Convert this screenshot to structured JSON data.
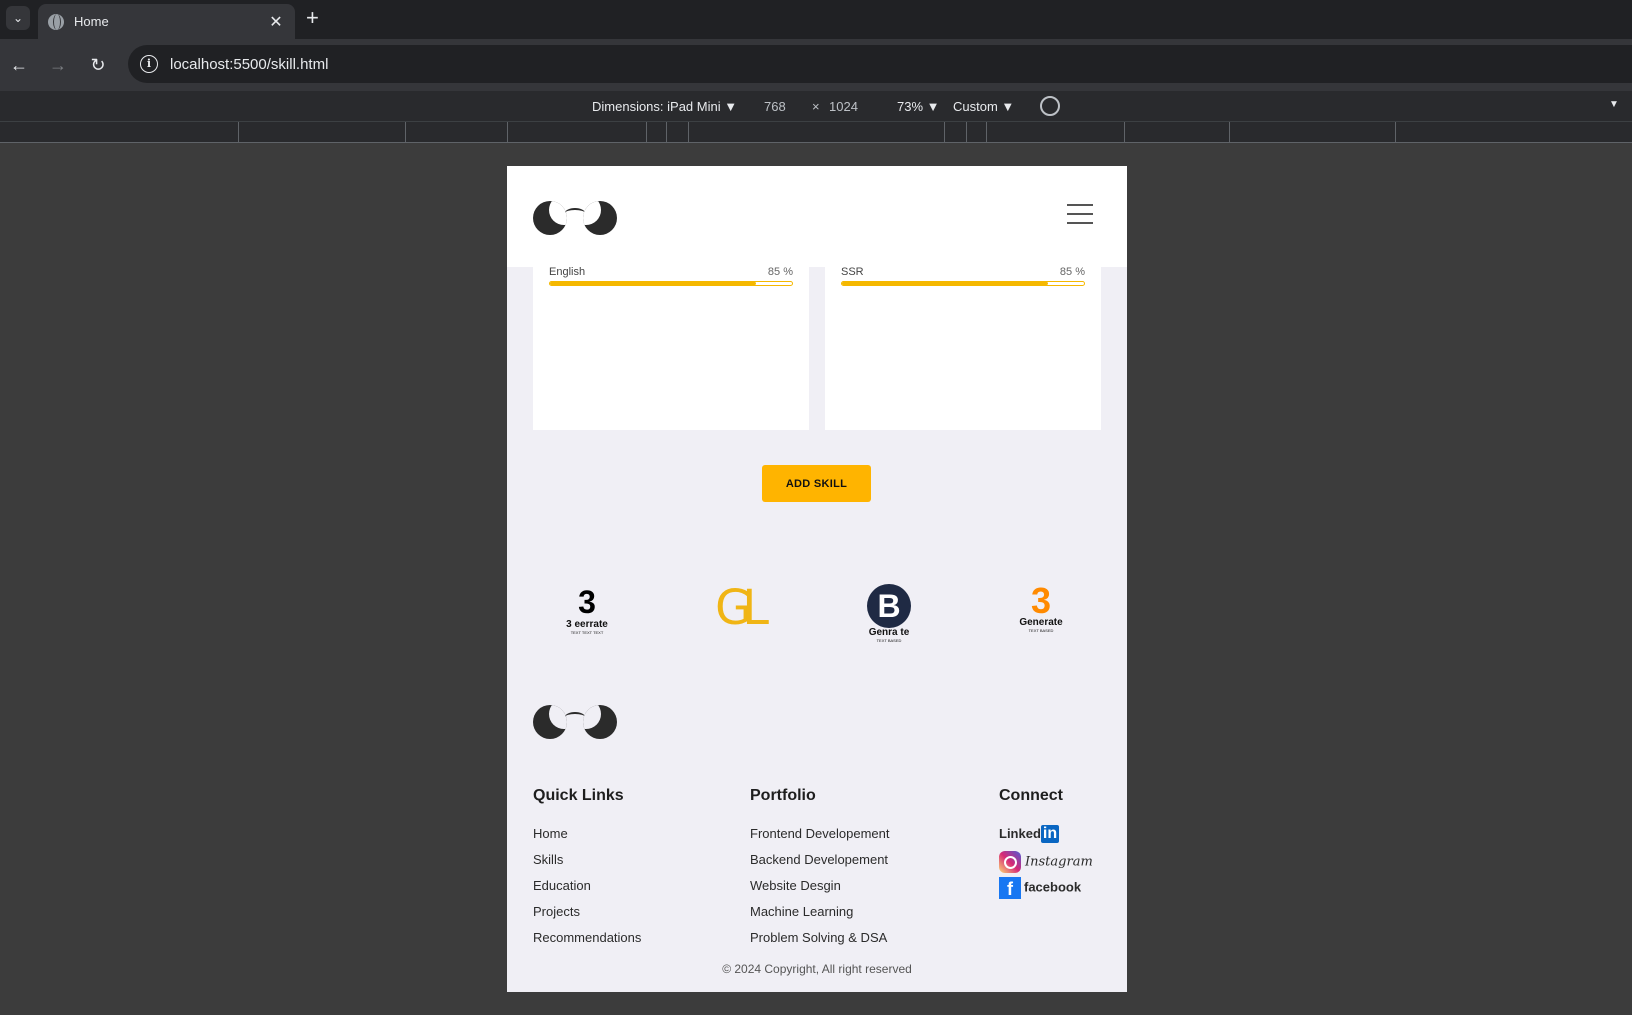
{
  "browser": {
    "tab_title": "Home",
    "url": "localhost:5500/skill.html"
  },
  "devtools": {
    "dimensions_label": "Dimensions: iPad Mini ▼",
    "width": "768",
    "times": "×",
    "height": "1024",
    "zoom": "73% ▼",
    "throttle": "Custom ▼",
    "more": "▼"
  },
  "skills": [
    {
      "name": "English",
      "percent_label": "85 %",
      "level": 0.85
    },
    {
      "name": "SSR",
      "percent_label": "85 %",
      "level": 0.85
    }
  ],
  "add_skill_label": "ADD SKILL",
  "brands": [
    {
      "mark": "3",
      "text": "3 eerrate",
      "sub": "TEXT TEXT TEXT"
    },
    {
      "mark": "GL"
    },
    {
      "mark": "B",
      "text": "Genra te",
      "sub": "TEXT BASED"
    },
    {
      "mark": "3",
      "text": "Generate",
      "sub": "TEXT BASED"
    }
  ],
  "footer": {
    "quick_links": {
      "title": "Quick Links",
      "items": [
        "Home",
        "Skills",
        "Education",
        "Projects",
        "Recommendations"
      ]
    },
    "portfolio": {
      "title": "Portfolio",
      "items": [
        "Frontend Developement",
        "Backend Developement",
        "Website Desgin",
        "Machine Learning",
        "Problem Solving & DSA"
      ]
    },
    "connect": {
      "title": "Connect",
      "linkedin": "Linked",
      "linkedin_in": "in",
      "instagram": "Instagram",
      "facebook": "facebook",
      "fb_glyph": "f"
    },
    "copyright": "© 2024 Copyright, All right reserved"
  },
  "colors": {
    "accent": "#ffb400",
    "page_bg": "#f0eff5",
    "linkedin": "#0a66c2",
    "facebook": "#1877f2"
  }
}
